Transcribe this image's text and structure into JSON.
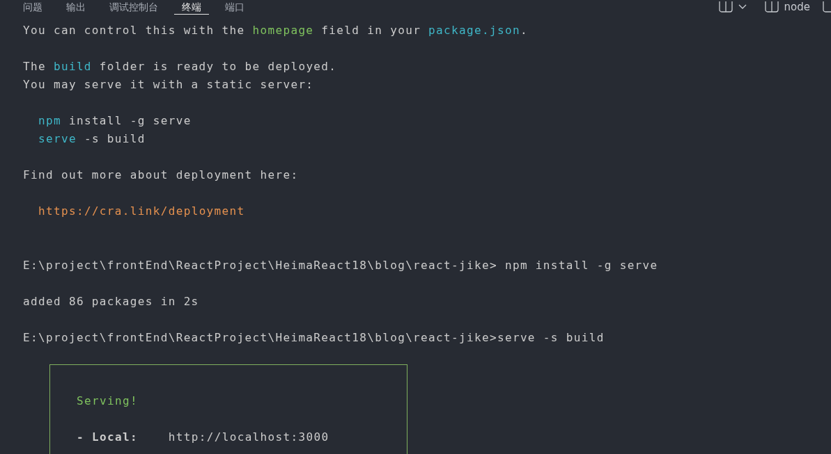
{
  "panel_tabs": [
    {
      "label": "问题",
      "selected": false
    },
    {
      "label": "输出",
      "selected": false
    },
    {
      "label": "调试控制台",
      "selected": false
    },
    {
      "label": "终端",
      "selected": true
    },
    {
      "label": "端口",
      "selected": false
    }
  ],
  "terminal_label": "node",
  "terminal_blocks": [
    {
      "kind": "start",
      "indented": false,
      "lines": [
        [
          {
            "text": "You can control this with the ",
            "kind": "plain"
          },
          {
            "text": "homepage",
            "kind": "green"
          },
          {
            "text": " field in your ",
            "kind": "plain"
          },
          {
            "text": "package.json",
            "kind": "cyan"
          },
          {
            "text": ".",
            "kind": "plain"
          }
        ]
      ]
    },
    {
      "kind": "paragraph",
      "indented": false,
      "lines": [
        [
          {
            "text": "The ",
            "kind": "plain"
          },
          {
            "text": "build",
            "kind": "cyan"
          },
          {
            "text": " folder is ready to be deployed.",
            "kind": "plain"
          }
        ],
        [
          {
            "text": "You may serve it with a static server:",
            "kind": "plain"
          }
        ]
      ]
    },
    {
      "kind": "paragraph",
      "indented": true,
      "lines": [
        [
          {
            "text": "npm",
            "kind": "cyan"
          },
          {
            "text": " install -g serve",
            "kind": "plain"
          }
        ],
        [
          {
            "text": "serve",
            "kind": "cyan"
          },
          {
            "text": " -s build",
            "kind": "plain"
          }
        ]
      ]
    },
    {
      "kind": "paragraph",
      "indented": false,
      "lines": [
        [
          {
            "text": "Find out more about deployment here:",
            "kind": "plain"
          }
        ]
      ]
    },
    {
      "kind": "paragraph",
      "indented": true,
      "lines": [
        [
          {
            "text": "https://cra.link/deployment",
            "kind": "orange"
          }
        ]
      ]
    },
    {
      "kind": "section",
      "indented": false,
      "lines": [
        [
          {
            "text": "E:\\project\\frontEnd\\ReactProject\\HeimaReact18\\blog\\react-jike> npm install -g serve",
            "kind": "plain"
          }
        ]
      ]
    },
    {
      "kind": "paragraph",
      "indented": false,
      "lines": [
        [
          {
            "text": "added 86 packages in 2s",
            "kind": "plain"
          }
        ]
      ]
    },
    {
      "kind": "paragraph",
      "indented": false,
      "lines": [
        [
          {
            "text": "E:\\project\\frontEnd\\ReactProject\\HeimaReact18\\blog\\react-jike>serve -s build",
            "kind": "plain"
          }
        ]
      ]
    }
  ],
  "serve_box": [
    [
      {
        "text": "Serving!",
        "kind": "green"
      }
    ],
    [
      {
        "text": "- Local:",
        "kind": "bold"
      },
      {
        "text": "    http://localhost:3000",
        "kind": "plain"
      }
    ]
  ]
}
